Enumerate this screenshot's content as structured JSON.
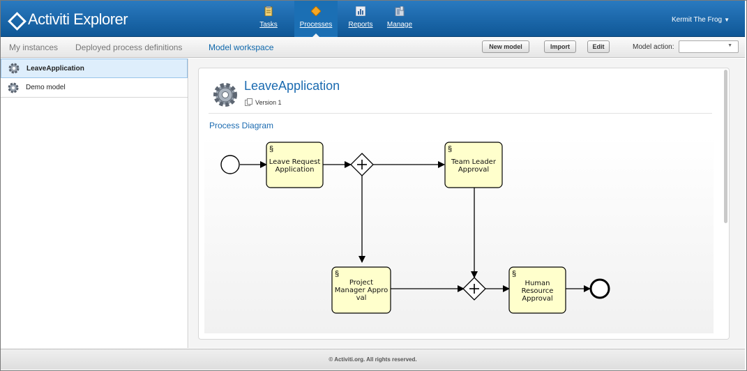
{
  "app": {
    "title": "Activiti Explorer",
    "user": "Kermit The Frog"
  },
  "nav": [
    {
      "label": "Tasks",
      "icon": "clipboard-icon"
    },
    {
      "label": "Processes",
      "icon": "diamond-icon",
      "active": true
    },
    {
      "label": "Reports",
      "icon": "chart-icon"
    },
    {
      "label": "Manage",
      "icon": "cabinet-icon"
    }
  ],
  "tabs": {
    "my_instances": "My instances",
    "deployed": "Deployed process definitions",
    "model_workspace": "Model workspace"
  },
  "toolbar": {
    "new_model": "New model",
    "import": "Import",
    "edit": "Edit",
    "model_action_label": "Model action:",
    "model_action_value": ""
  },
  "sidebar": {
    "items": [
      {
        "label": "LeaveApplication",
        "icon": "gear-icon",
        "selected": true
      },
      {
        "label": "Demo model",
        "icon": "gear-icon",
        "selected": false
      }
    ]
  },
  "model": {
    "name": "LeaveApplication",
    "version": "Version 1",
    "diagram_heading": "Process Diagram"
  },
  "diagram": {
    "tasks": {
      "leave_request": [
        "Leave Request",
        "Application"
      ],
      "team_leader": [
        "Team Leader",
        "Approval"
      ],
      "project_manager": [
        "Project",
        "Manager Appro",
        "val"
      ],
      "hr": [
        "Human",
        "Resource",
        "Approval"
      ]
    }
  },
  "footer": "© Activiti.org. All rights reserved.",
  "colors": {
    "header": "#175f9f",
    "accent": "#1a6ab0",
    "task_fill": "#ffffcc"
  }
}
